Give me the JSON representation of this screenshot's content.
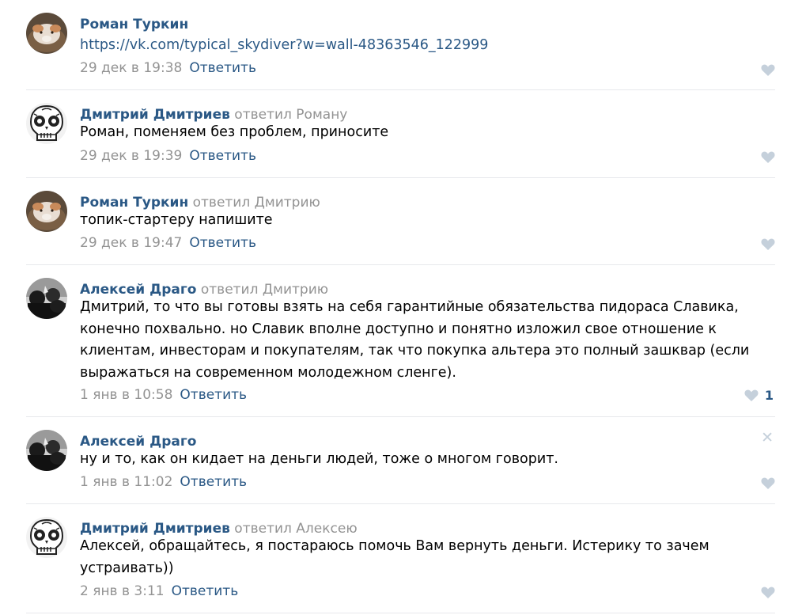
{
  "comments": [
    {
      "author": "Роман Туркин",
      "reply_to": "",
      "text_is_link": true,
      "text": "https://vk.com/typical_skydiver?w=wall-48363546_122999",
      "date": "29 дек в 19:38",
      "reply_label": "Ответить",
      "likes": "",
      "avatar_icon": "user-photo-guinea-pig"
    },
    {
      "author": "Дмитрий Дмитриев",
      "reply_to": "ответил Роману",
      "text": "Роман, поменяем без проблем, приносите",
      "date": "29 дек в 19:39",
      "reply_label": "Ответить",
      "likes": "",
      "avatar_icon": "user-photo-sugar-skull"
    },
    {
      "author": "Роман Туркин",
      "reply_to": "ответил Дмитрию",
      "text": "топик-стартеру напишите",
      "date": "29 дек в 19:47",
      "reply_label": "Ответить",
      "likes": "",
      "avatar_icon": "user-photo-guinea-pig"
    },
    {
      "author": "Алексей Драго",
      "reply_to": "ответил Дмитрию",
      "text": "Дмитрий, то что вы готовы взять на себя гарантийные обязательства пидораса Славика, конечно похвально. но Славик вполне доступно и понятно изложил свое отношение к клиентам, инвесторам и покупателям, так что покупка альтера это полный зашквар (если выражаться на современном молодежном сленге).",
      "date": "1 янв в 10:58",
      "reply_label": "Ответить",
      "likes": "1",
      "avatar_icon": "user-photo-dark-crowd"
    },
    {
      "author": "Алексей Драго",
      "reply_to": "",
      "text": "ну и то, как он кидает на деньги людей, тоже о многом говорит.",
      "date": "1 янв в 11:02",
      "reply_label": "Ответить",
      "likes": "",
      "close_icon": "close-icon",
      "avatar_icon": "user-photo-dark-crowd"
    },
    {
      "author": "Дмитрий Дмитриев",
      "reply_to": "ответил Алексею",
      "text": "Алексей, обращайтесь, я постараюсь помочь Вам вернуть деньги. Истерику то зачем устраивать))",
      "date": "2 янв в 3:11",
      "reply_label": "Ответить",
      "likes": "",
      "avatar_icon": "user-photo-sugar-skull"
    }
  ],
  "icons": {
    "like": "heart-icon",
    "close": "close-icon",
    "close_glyph": "✕"
  },
  "colors": {
    "link": "#2a5885",
    "meta": "#939393",
    "icon": "#c5d0db",
    "divider": "#e7e8ec"
  }
}
